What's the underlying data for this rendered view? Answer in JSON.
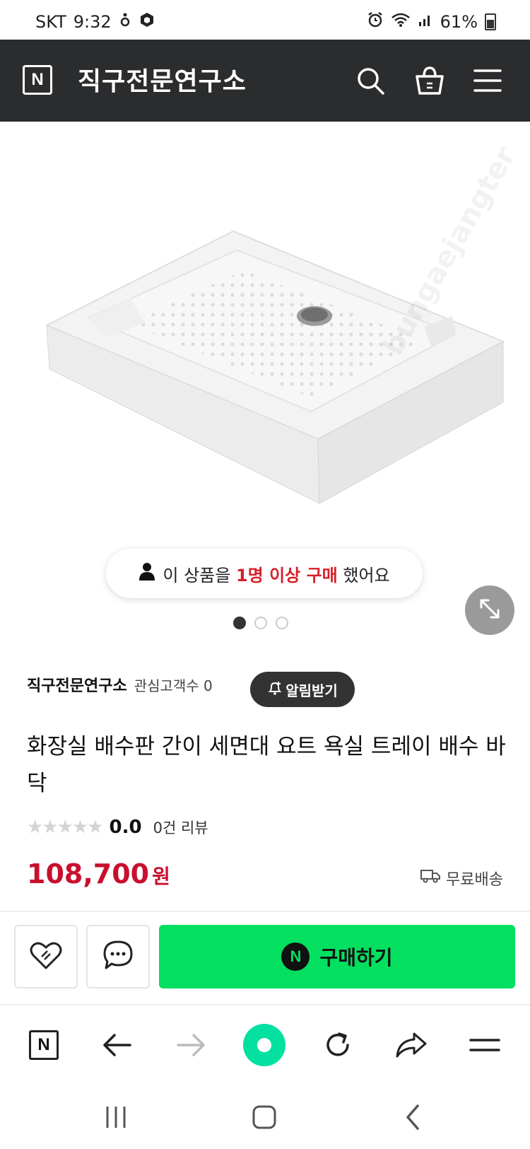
{
  "status_bar": {
    "carrier": "SKT",
    "time": "9:32",
    "battery": "61%"
  },
  "header": {
    "logo_letter": "N",
    "store_name": "직구전문연구소"
  },
  "gallery": {
    "buyers_prefix": "이 상품을 ",
    "buyers_highlight": "1명 이상 구매",
    "buyers_suffix": " 했어요",
    "page_count": 3,
    "active_index": 0
  },
  "seller": {
    "name": "직구전문연구소",
    "fans_label": "관심고객수 0",
    "alarm_label": "알림받기"
  },
  "product": {
    "title": "화장실 배수판 간이 세면대 요트 욕실 트레이 배수 바닥",
    "stars": "★★★★★",
    "score": "0.0",
    "review_label": "0건 리뷰",
    "rating_fraction": 0,
    "price": "108,700",
    "currency": "원",
    "shipping": "무료배송"
  },
  "buy_bar": {
    "buy_label": "구매하기",
    "buy_logo": "N"
  },
  "browser_bar": {
    "home_letter": "N"
  },
  "colors": {
    "header_bg": "#2b2c2e",
    "buy_green": "#03e060",
    "price_red": "#c8102e",
    "highlight_red": "#d6202a"
  }
}
